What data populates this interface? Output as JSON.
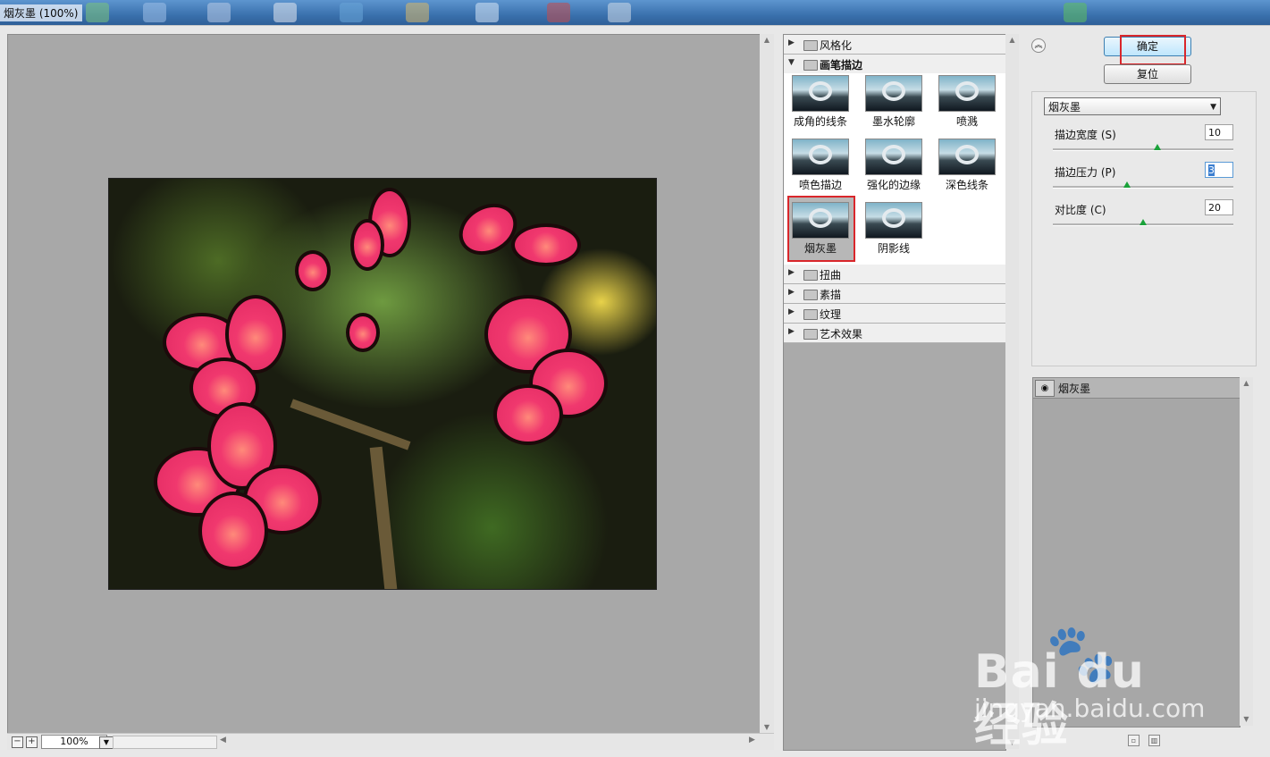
{
  "window": {
    "title": "烟灰墨 (100%)"
  },
  "preview": {
    "zoom": "100%",
    "zoom_out": "−",
    "zoom_in": "+"
  },
  "filter_gallery": {
    "categories_top": [
      {
        "label": "风格化",
        "expanded": false
      },
      {
        "label": "画笔描边",
        "expanded": true
      }
    ],
    "thumbnails": [
      {
        "label": "成角的线条"
      },
      {
        "label": "墨水轮廓"
      },
      {
        "label": "喷溅"
      },
      {
        "label": "喷色描边"
      },
      {
        "label": "强化的边缘"
      },
      {
        "label": "深色线条"
      },
      {
        "label": "烟灰墨",
        "selected": true
      },
      {
        "label": "阴影线"
      }
    ],
    "categories_bottom": [
      {
        "label": "扭曲"
      },
      {
        "label": "素描"
      },
      {
        "label": "纹理"
      },
      {
        "label": "艺术效果"
      }
    ]
  },
  "actions": {
    "ok": "确定",
    "reset": "复位"
  },
  "settings": {
    "filter_select": "烟灰墨",
    "params": [
      {
        "label": "描边宽度 (S)",
        "value": "10",
        "fraction": 0.58
      },
      {
        "label": "描边压力 (P)",
        "value": "3",
        "fraction": 0.41,
        "focused": true
      },
      {
        "label": "对比度 (C)",
        "value": "20",
        "fraction": 0.5
      }
    ]
  },
  "layers": [
    {
      "label": "烟灰墨",
      "visible": true
    }
  ],
  "watermark": {
    "brand": "Bai du 经验",
    "url": "jingyan.baidu.com"
  },
  "colors": {
    "highlight": "#d9262b",
    "ok_button": "#bee6fd",
    "slider_knob": "#1aa23a"
  }
}
